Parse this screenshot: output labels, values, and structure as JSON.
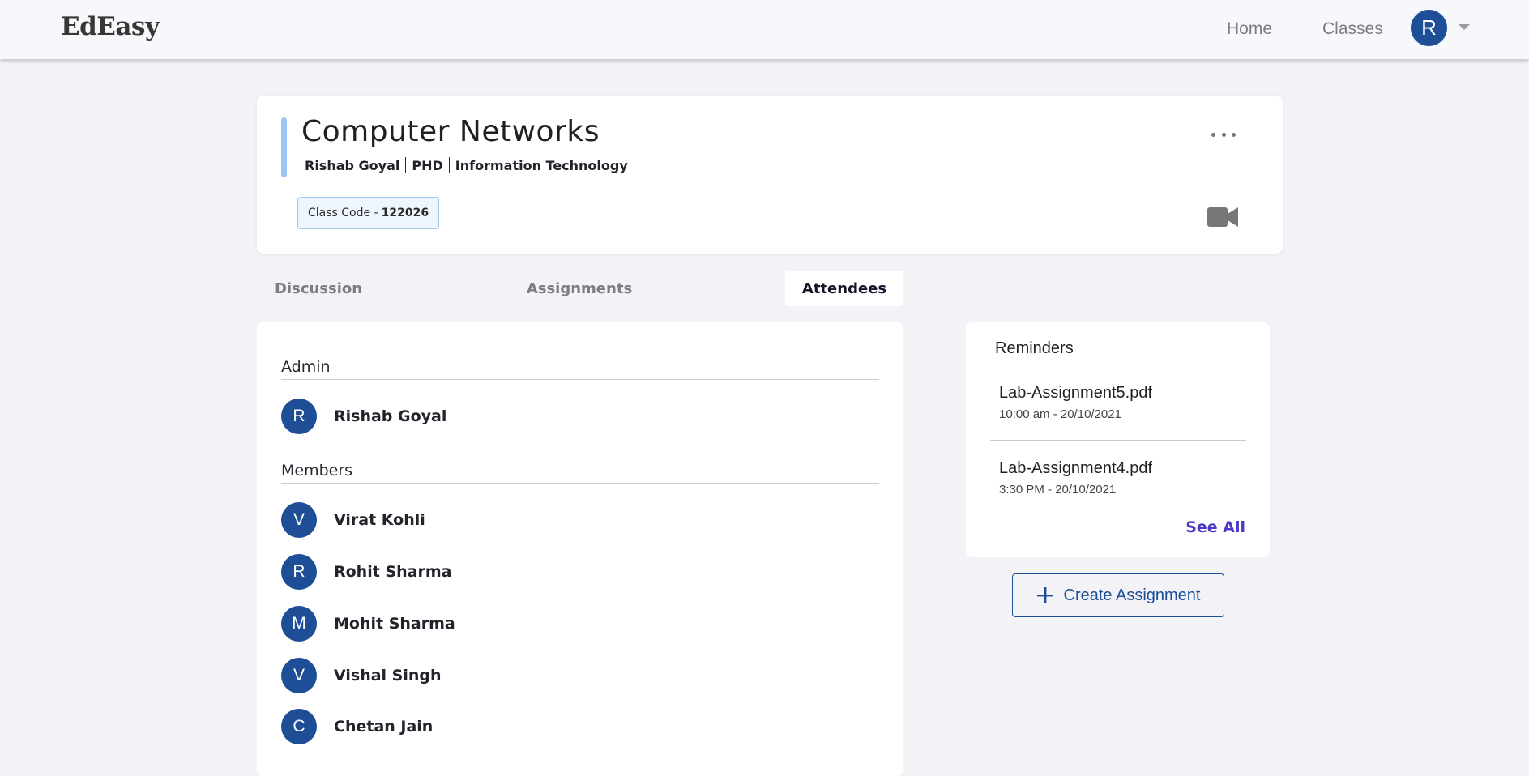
{
  "nav": {
    "brand": "EdEasy",
    "links": [
      "Home",
      "Classes"
    ],
    "avatar_initial": "R"
  },
  "class": {
    "title": "Computer Networks",
    "teacher": "Rishab Goyal",
    "degree": "PHD",
    "department": "Information Technology",
    "code_label": "Class Code -",
    "code_value": "122026"
  },
  "tabs": [
    {
      "label": "Discussion",
      "active": false
    },
    {
      "label": "Assignments",
      "active": false
    },
    {
      "label": "Attendees",
      "active": true
    }
  ],
  "attendees": {
    "admin_heading": "Admin",
    "admins": [
      {
        "initial": "R",
        "name": "Rishab Goyal"
      }
    ],
    "members_heading": "Members",
    "members": [
      {
        "initial": "V",
        "name": "Virat Kohli"
      },
      {
        "initial": "R",
        "name": "Rohit Sharma"
      },
      {
        "initial": "M",
        "name": "Mohit Sharma"
      },
      {
        "initial": "V",
        "name": "Vishal Singh"
      },
      {
        "initial": "C",
        "name": "Chetan Jain"
      }
    ]
  },
  "reminders": {
    "title": "Reminders",
    "items": [
      {
        "file": "Lab-Assignment5.pdf",
        "time": "10:00 am - 20/10/2021"
      },
      {
        "file": "Lab-Assignment4.pdf",
        "time": "3:30 PM - 20/10/2021"
      }
    ],
    "see_all": "See All"
  },
  "create_assignment_label": "Create Assignment",
  "icons": {
    "more": "more-horizontal-icon",
    "video": "video-camera-icon",
    "plus": "plus-icon",
    "dropdown": "caret-down-icon"
  },
  "colors": {
    "accent": "#1d4e96",
    "link": "#4b3bc4",
    "background": "#f2f2f7",
    "class_accent": "#9cc4f5"
  }
}
